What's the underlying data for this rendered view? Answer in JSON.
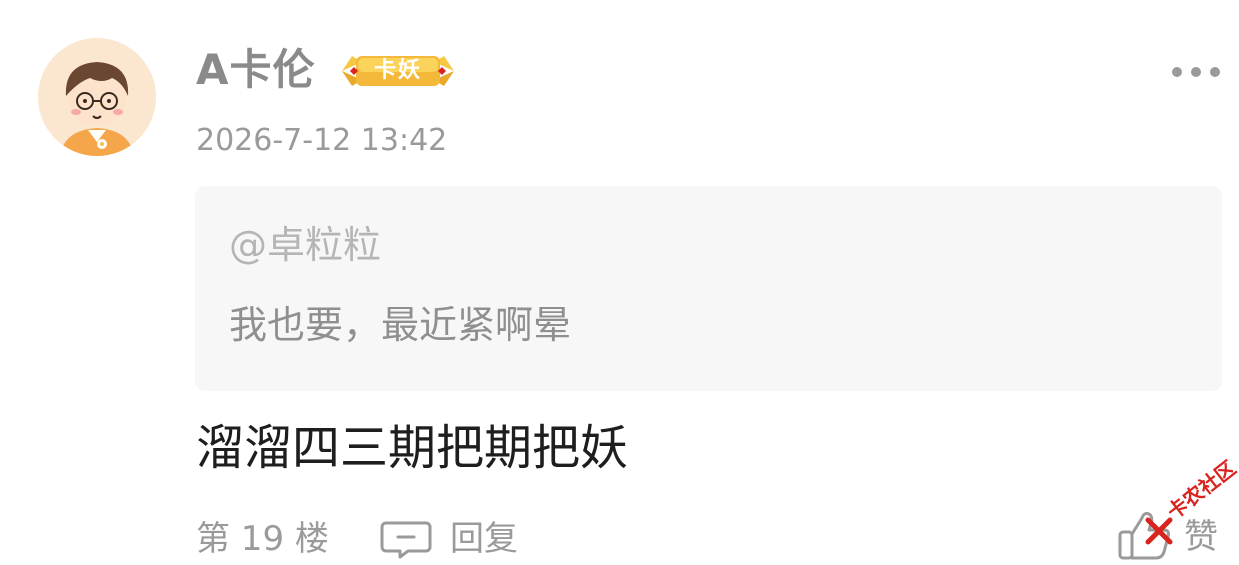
{
  "user": {
    "name": "A卡伦",
    "badge": "卡妖"
  },
  "post": {
    "timestamp": "2026-7-12 13:42",
    "quote": {
      "mention": "@卓粒粒",
      "text": "我也要，最近紧啊晕"
    },
    "content": "溜溜四三期把期把妖"
  },
  "footer": {
    "floor": "第 19 楼",
    "reply_label": "回复",
    "like_label": "赞"
  },
  "watermark": {
    "text": "卡农社区"
  },
  "icons": {
    "more": "more-horizontal-icon",
    "reply": "comment-bubble-icon",
    "like": "thumbs-up-icon"
  },
  "colors": {
    "username": "#8a8a8a",
    "badge_gold": "#f7c843",
    "quote_bg": "#f7f7f7",
    "watermark_red": "#d8231e"
  }
}
